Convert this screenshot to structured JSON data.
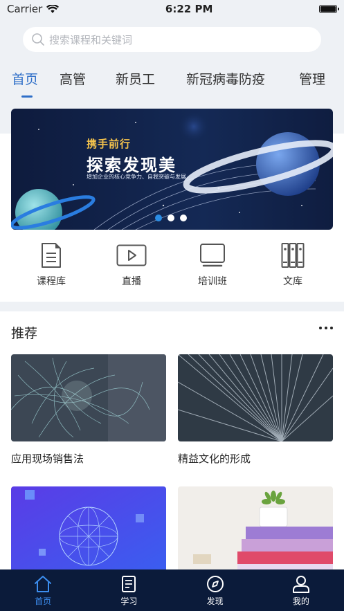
{
  "status": {
    "carrier": "Carrier",
    "time": "6:22 PM"
  },
  "search": {
    "placeholder": "搜索课程和关键词"
  },
  "tabs": [
    {
      "label": "首页",
      "active": true
    },
    {
      "label": "高管"
    },
    {
      "label": "新员工"
    },
    {
      "label": "新冠病毒防疫"
    },
    {
      "label": "管理"
    }
  ],
  "banner": {
    "subtitle": "携手前行",
    "title": "探索发现美",
    "description": "增加企业的核心竞争力、自我突破与发展",
    "slide_count": 3,
    "active_slide": 1
  },
  "quick_links": [
    {
      "label": "课程库",
      "icon": "document-icon"
    },
    {
      "label": "直播",
      "icon": "play-icon"
    },
    {
      "label": "培训班",
      "icon": "monitor-icon"
    },
    {
      "label": "文库",
      "icon": "books-icon"
    }
  ],
  "recommend": {
    "title": "推荐",
    "items": [
      {
        "caption": "应用现场销售法"
      },
      {
        "caption": "精益文化的形成"
      },
      {
        "caption": ""
      },
      {
        "caption": ""
      }
    ]
  },
  "tabbar": [
    {
      "label": "首页",
      "icon": "home-icon",
      "active": true
    },
    {
      "label": "学习",
      "icon": "notebook-icon"
    },
    {
      "label": "发现",
      "icon": "compass-icon"
    },
    {
      "label": "我的",
      "icon": "user-icon"
    }
  ],
  "colors": {
    "accent": "#2f6fc8",
    "tabbar_bg": "#0b1b3a",
    "tabbar_active": "#3c8ef0"
  }
}
